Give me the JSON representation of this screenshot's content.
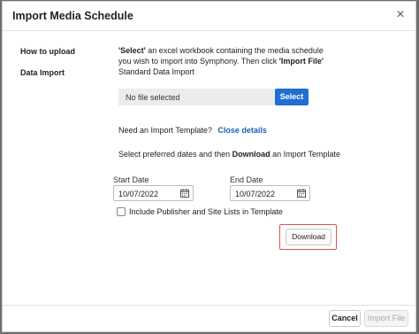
{
  "dialog": {
    "title": "Import Media Schedule",
    "close_glyph": "×"
  },
  "how_to_upload": {
    "label": "How to upload",
    "line1_bold": "'Select'",
    "line1_rest": " an excel workbook containing the media schedule",
    "line2_pre": "you wish to import into Symphony. Then click ",
    "line2_bold": "'Import File'"
  },
  "data_import": {
    "label": "Data Import",
    "value": "Standard Data Import"
  },
  "file_picker": {
    "status": "No file selected",
    "select_label": "Select"
  },
  "template": {
    "prompt": "Need an Import Template?",
    "close_link": "Close details",
    "instruction_pre": "Select preferred dates and then ",
    "instruction_bold": "Download",
    "instruction_post": " an Import Template"
  },
  "dates": {
    "start_label": "Start Date",
    "start_value": "10/07/2022",
    "end_label": "End Date",
    "end_value": "10/07/2022"
  },
  "checkbox": {
    "label": "Include Publisher and Site Lists in Template",
    "checked": false
  },
  "download_label": "Download",
  "footer": {
    "cancel_label": "Cancel",
    "import_label": "Import File"
  },
  "colors": {
    "primary": "#1f6fd0",
    "link": "#1f5fb5",
    "highlight": "#d9534f"
  },
  "icons": [
    "close-icon",
    "calendar-icon"
  ]
}
